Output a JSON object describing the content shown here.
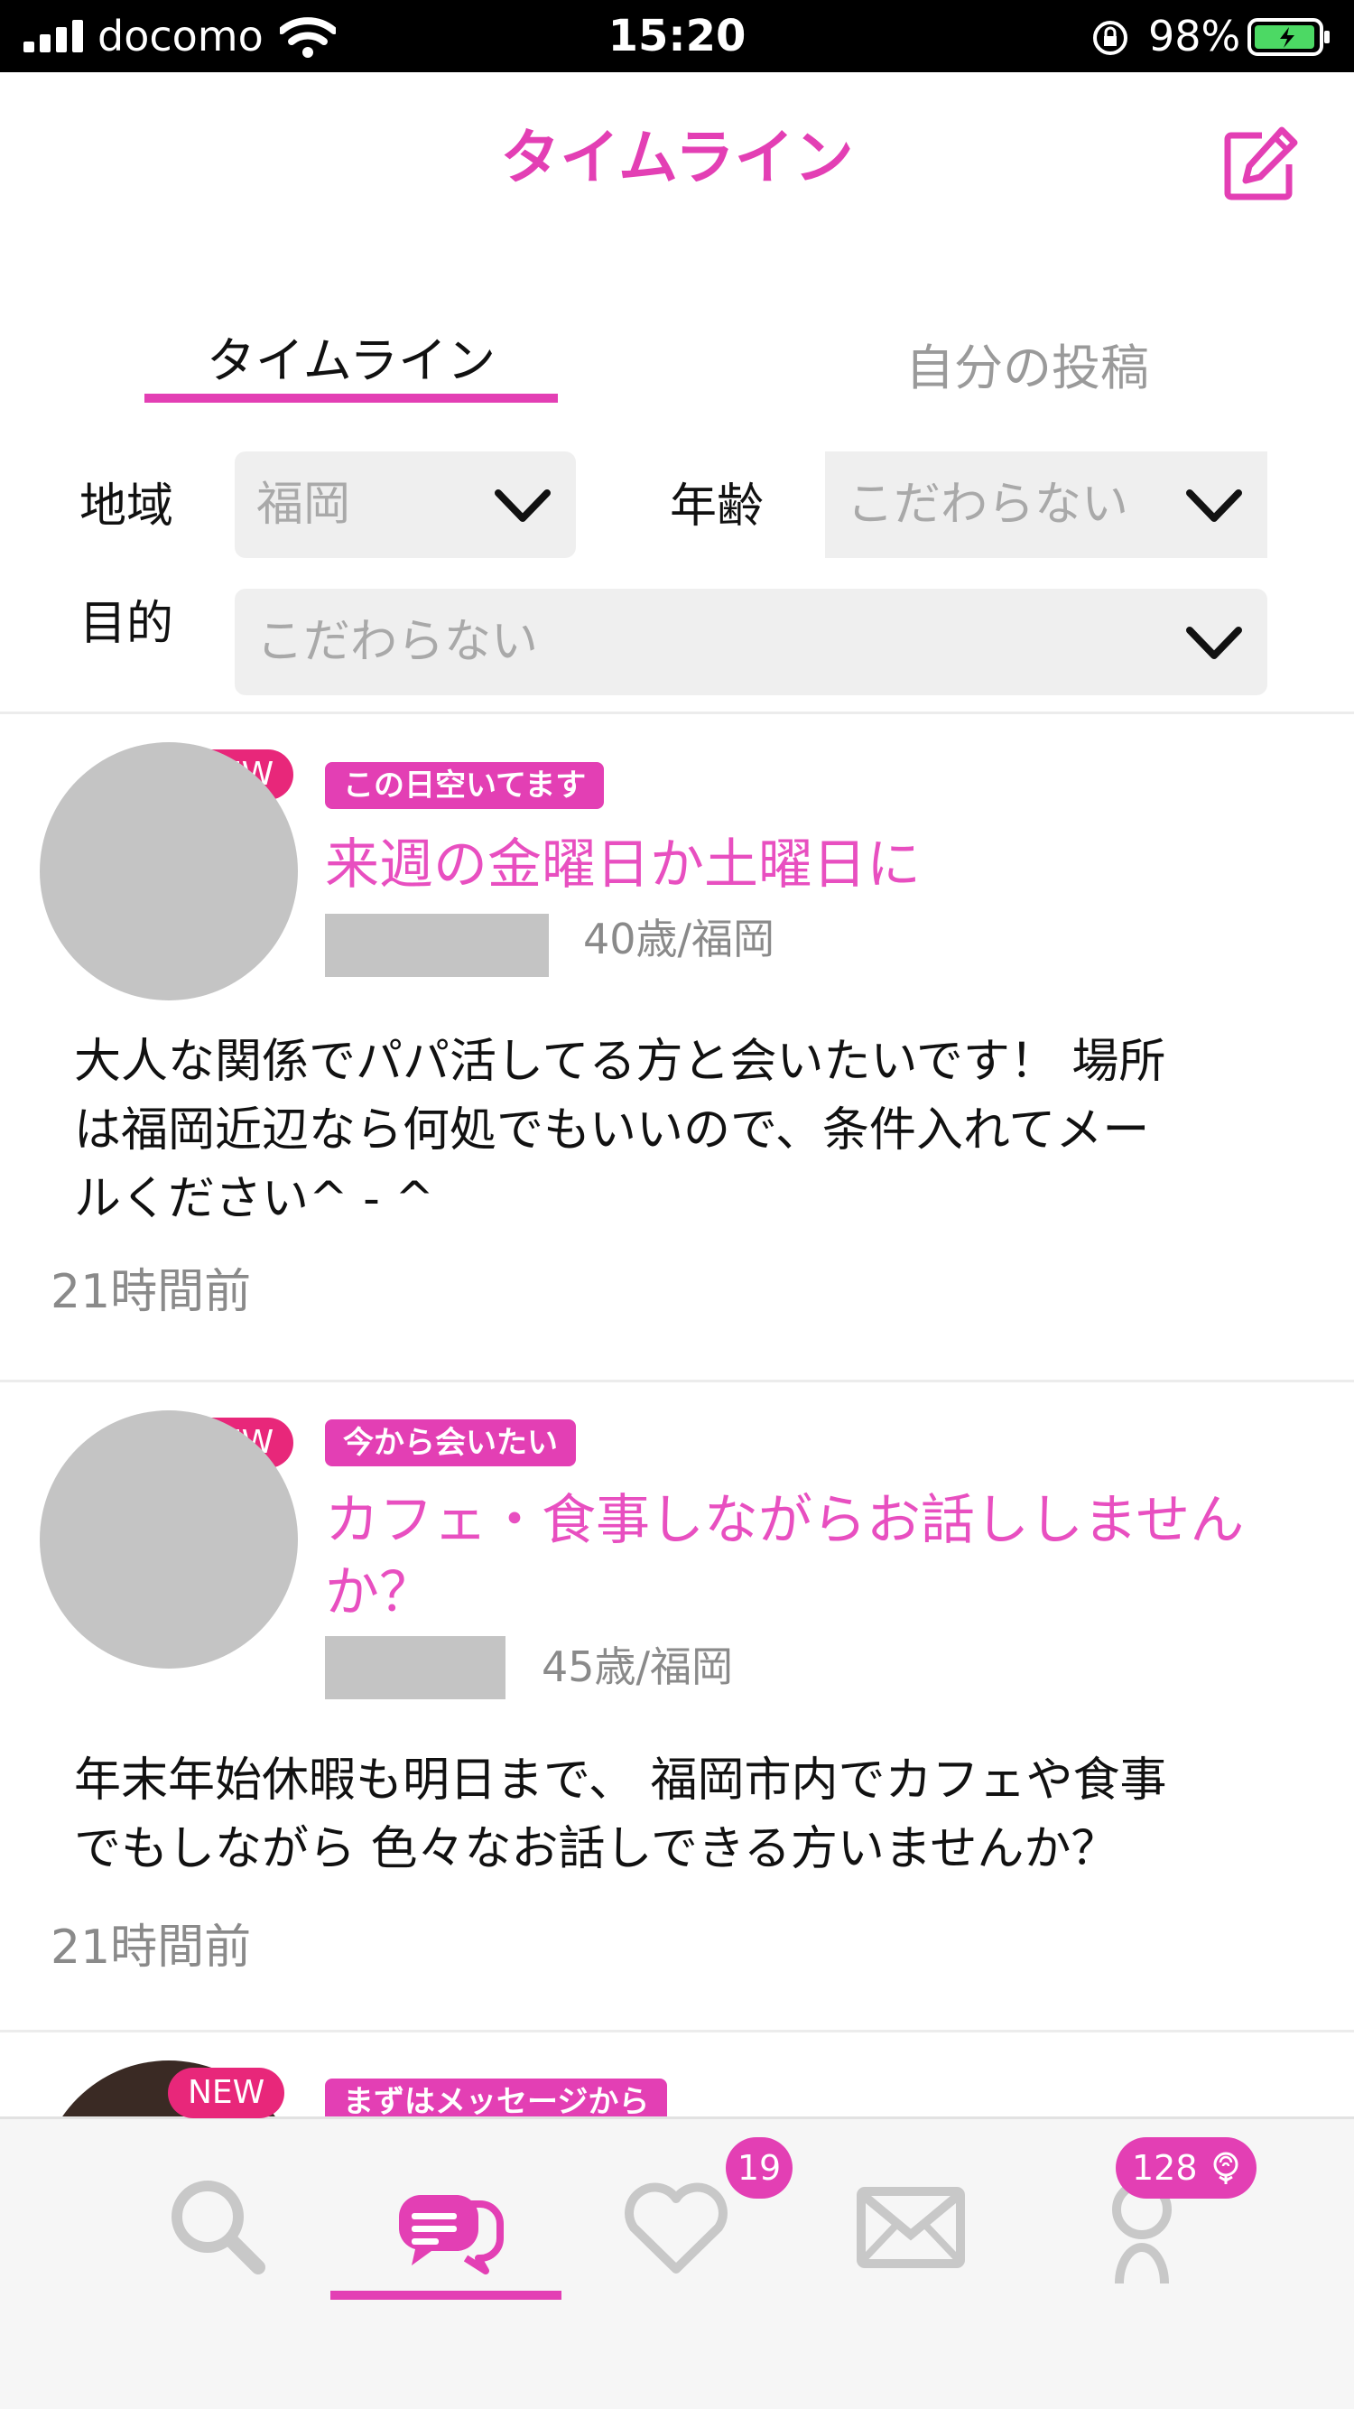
{
  "status_bar": {
    "carrier": "docomo",
    "time": "15:20",
    "battery": "98%"
  },
  "header": {
    "title": "タイムライン"
  },
  "tabs": [
    {
      "label": "タイムライン",
      "active": true
    },
    {
      "label": "自分の投稿",
      "active": false
    }
  ],
  "filters": {
    "region": {
      "label": "地域",
      "value": "福岡"
    },
    "age": {
      "label": "年齢",
      "value": "こだわらない"
    },
    "purpose": {
      "label": "目的",
      "value": "こだわらない"
    }
  },
  "posts": [
    {
      "new_label": "NEW",
      "tag": "この日空いてます",
      "title": "来週の金曜日か土曜日に",
      "meta": "40歳/福岡",
      "body": "大人な関係でパパ活してる方と会いたいです！ 場所\nは福岡近辺なら何処でもいいので、条件入れてメー\nルください^ - ^",
      "time_ago": "21時間前"
    },
    {
      "new_label": "NEW",
      "tag": "今から会いたい",
      "title": "カフェ・食事しながらお話ししません\nか？",
      "meta": "45歳/福岡",
      "body": "年末年始休暇も明日まで、 福岡市内でカフェや食事\nでもしながら 色々なお話しできる方いませんか？",
      "time_ago": "21時間前"
    },
    {
      "new_label": "NEW",
      "tag": "まずはメッセージから"
    }
  ],
  "tabbar": {
    "items": [
      {
        "icon": "search-icon"
      },
      {
        "icon": "timeline-icon",
        "active": true
      },
      {
        "icon": "heart-icon",
        "badge": "19"
      },
      {
        "icon": "mail-icon"
      },
      {
        "icon": "profile-icon",
        "badge": "128"
      }
    ]
  },
  "colors": {
    "accent": "#e33fb4",
    "new_badge": "#e8277a",
    "placeholder_gray": "#c4c4c4"
  }
}
